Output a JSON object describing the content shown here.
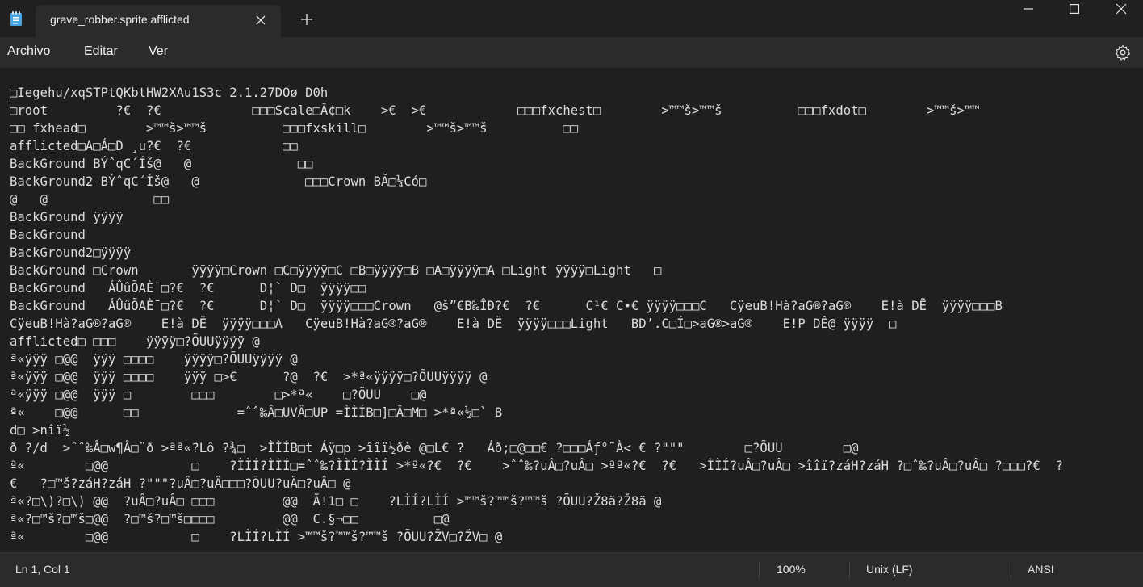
{
  "window": {
    "tab_title": "grave_robber.sprite.afflicted"
  },
  "menu": {
    "items": [
      "Archivo",
      "Editar",
      "Ver"
    ]
  },
  "editor": {
    "lines": [
      "□Iegehu/xqSTPtQKbtHW2XAu1S3c 2.1.27DOø D0h",
      "□root         ?€  ?€            □□□Scale□Â¢□k    >€  >€            □□□fxchest□        >™™š>™™š          □□□fxdot□        >™™š>™™",
      "□□ fxhead□        >™™š>™™š          □□□fxskill□        >™™š>™™š          □□",
      "afflicted□A□Á□D ¸u?€  ?€            □□",
      "BackGround BÝˆqC´Íš@   @              □□",
      "BackGround2 BÝˆqC´Íš@   @              □□□Crown BÃ□¼Có□",
      "@   @              □□",
      "BackGround ÿÿÿÿ",
      "BackGround",
      "BackGround2□ÿÿÿÿ",
      "BackGround □Crown       ÿÿÿÿ□Crown □C□ÿÿÿÿ□C □B□ÿÿÿÿ□B □A□ÿÿÿÿ□A □Light ÿÿÿÿ□Light   □",
      "BackGround   ÁÛûÕAÈ¯□?€  ?€      D¦` D□  ÿÿÿÿ□□",
      "BackGround   ÁÛûÕAÈ¯□?€  ?€      D¦` D□  ÿÿÿÿ□□□Crown   @š”€B‰ÎÐ?€  ?€      C¹€ C•€ ÿÿÿÿ□□□C   CÿeuB!Hà?aG®?aG®    E!à DË  ÿÿÿÿ□□□B",
      "CÿeuB!Hà?aG®?aG®    E!à DË  ÿÿÿÿ□□□A   CÿeuB!Hà?aG®?aG®    E!à DË  ÿÿÿÿ□□□Light   BD’.C□Í□>aG®>aG®    E!P DÊ@ ÿÿÿÿ  □",
      "afflicted□ □□□    ÿÿÿÿ□?ÕUUÿÿÿÿ @",
      "ª«ÿÿÿ □@@  ÿÿÿ □□□□    ÿÿÿÿ□?ÕUUÿÿÿÿ @",
      "ª«ÿÿÿ □@@  ÿÿÿ □□□□    ÿÿÿ □>€      ?@  ?€  >*ª«ÿÿÿÿ□?ÕUUÿÿÿÿ @",
      "ª«ÿÿÿ □@@  ÿÿÿ □        □□□        □>*ª«    □?ÕUU    □@",
      "ª«    □@@      □□             =ˆˆ‰Â□UVÂ□UP =ÌÌÍB□]□Â□M□ >*ª«½□` B",
      "d□ >nîï½",
      "ð ?/d  >ˆˆ‰Â□w¶Â□¨ð >ªª«?Lô ?¾□  >ÌÌÍB□t Áÿ□p >îîï½ðè @□L€ ?   Áð;□@□□€ ?□□□Áƒ°˜À< € ?\"\"\"        □?ÕUU        □@",
      "ª«        □@@           □    ?ÌÌÍ?ÌÌÍ□=ˆˆ‰?ÌÌÍ?ÌÌÍ >*ª«?€  ?€    >ˆˆ‰?uÂ□?uÂ□ >ªª«?€  ?€   >ÌÌÍ?uÂ□?uÂ□ >îîï?záH?záH ?□ˆ‰?uÂ□?uÂ□ ?□□□?€  ?",
      "€   ?□™š?záH?záH ?\"\"\"?uÂ□?uÂ□□□?ÕUU?uÂ□?uÂ□ @",
      "ª«?□\\)?□\\) @@  ?uÂ□?uÂ□ □□□         @@  Ã!1□ □    ?LÌÍ?LÌÍ >™™š?™™š?™™š ?ÕUU?Ž8ä?Ž8ä @",
      "ª«?□™š?□™š□@@  ?□™š?□™š□□□□         @@  C.§¬□□          □@",
      "ª«        □@@           □    ?LÌÍ?LÌÍ >™™š?™™š?™™š ?ÕUU?ŽV□?ŽV□ @"
    ]
  },
  "status": {
    "position": "Ln 1, Col 1",
    "zoom": "100%",
    "line_ending": "Unix (LF)",
    "encoding": "ANSI"
  },
  "colors": {
    "background": "#1f1f1f",
    "chrome": "#2b2b2b",
    "text": "#e6e6e6"
  },
  "icons": {
    "app": "notepad-icon",
    "close_tab": "close-icon",
    "new_tab": "plus-icon",
    "minimize": "minimize-icon",
    "maximize": "maximize-icon",
    "close_window": "close-icon",
    "settings": "gear-icon"
  }
}
